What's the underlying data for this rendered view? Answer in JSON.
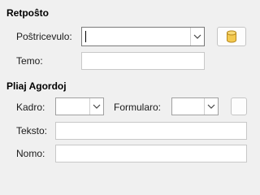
{
  "sections": {
    "retposto": {
      "title": "Retpoŝto",
      "recipient_label": "Poŝtricevulo:",
      "recipient_value": "",
      "subject_label": "Temo:",
      "subject_value": ""
    },
    "settings": {
      "title": "Pliaj Agordoj",
      "format_label": "Kadro:",
      "format_value": "",
      "form_label": "Formularo:",
      "form_value": "",
      "text_label": "Teksto:",
      "text_value": "",
      "name_label": "Nomo:",
      "name_value": ""
    }
  },
  "icons": {
    "address_book": "database-icon",
    "combo_arrow": "chevron-down-icon"
  },
  "colors": {
    "window_bg": "#f0f0f0",
    "icon_fill": "#f3c94f",
    "icon_stroke": "#b8891e"
  }
}
